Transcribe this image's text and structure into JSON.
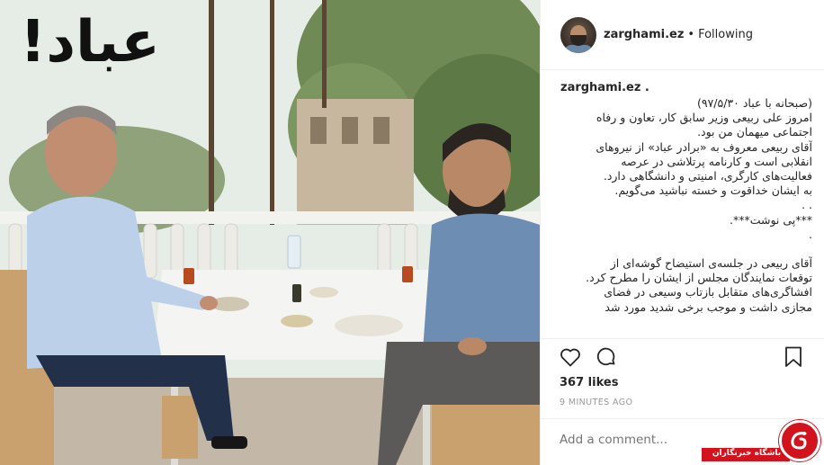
{
  "post": {
    "overlay_title": "عباد!",
    "username": "zarghami.ez",
    "separator": "•",
    "follow_status": "Following"
  },
  "caption": {
    "username": "zarghami.ez .",
    "lines": [
      "(صبحانه با عباد ۹۷/۵/۳۰)",
      "امروز علی ربیعی وزیر سابق کار، تعاون و رفاه",
      "اجتماعی میهمان من بود.",
      "آقای ربیعی معروف به «برادر عباد» از نیروهای",
      "انقلابی است و کارنامه پرتلاشی در عرصه",
      "فعالیت‌های کارگری، امنیتی و دانشگاهی دارد.",
      "به ایشان خداقوت و خسته نباشید می‌گویم.",
      ". .",
      "***پی نوشت***.",
      ".",
      "",
      "آقای ربیعی در جلسه‌ی استیضاح گوشه‌ای از",
      "توقعات نمایندگان مجلس از ایشان را مطرح کرد.",
      "افشاگری‌های متقابل بازتاب وسیعی در فضای",
      "مجازی داشت و موجب برخی شدید مورد شد"
    ]
  },
  "actions": {
    "like_icon": "heart-icon",
    "comment_icon": "comment-icon",
    "save_icon": "bookmark-icon"
  },
  "likes_text": "367 likes",
  "time_text": "9 MINUTES AGO",
  "comment": {
    "placeholder": "Add a comment..."
  },
  "watermark": {
    "text": "باشگاه خبرنگاران",
    "color": "#d2121d"
  }
}
